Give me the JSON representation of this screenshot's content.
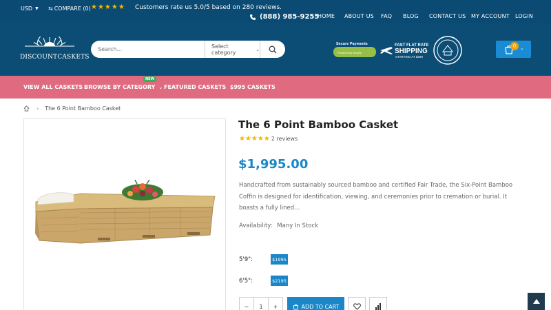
{
  "topbar": {
    "currency": "USD",
    "compare": "COMPARE (0)",
    "stars": "★★★★★",
    "rating_text": "Customers rate us 5.0/5 based on 280 reviews.",
    "phone": "(888) 985-9255",
    "nav": [
      "HOME",
      "ABOUT US",
      "FAQ",
      "BLOG",
      "CONTACT US",
      "MY ACCOUNT",
      "LOGIN"
    ]
  },
  "header": {
    "logo_text": "DISCOUNTCASKETS",
    "search_placeholder": "Search...",
    "category_select": "Select category",
    "secure_payments": "Secure Payments",
    "shopify_label": "Powered by shopify",
    "shipping_line1": "FAST FLAT RATE",
    "shipping_line2": "SHIPPING",
    "shipping_line3": "STARTING AT $299",
    "cart_count": "0"
  },
  "menu": {
    "items": [
      "VIEW ALL CASKETS",
      "BROWSE BY CATEGORY",
      "FEATURED CASKETS",
      "$995 CASKETS"
    ],
    "new_badge": "NEW"
  },
  "breadcrumb": {
    "current": "The 6 Point Bamboo Casket"
  },
  "product": {
    "title": "The 6 Point Bamboo Casket",
    "stars": "★★★★★",
    "reviews": "2 reviews",
    "rating": 5,
    "price": "$1,995.00",
    "description": "Handcrafted from sustainably sourced bamboo and certified Fair Trade, the Six-Point Bamboo Coffin is designed for identification, viewing, and ceremonies prior to cremation or burial. It boasts a fully lined...",
    "availability_label": "Availability:",
    "availability_value": "Many In Stock",
    "sizes": [
      {
        "label": "5'9\":",
        "price": "$1995"
      },
      {
        "label": "6'5\":",
        "price": "$2195"
      }
    ],
    "quantity": "1",
    "minus": "−",
    "plus": "+",
    "add_to_cart": "ADD TO CART"
  },
  "colors": {
    "topbar": "#0a4a73",
    "menu": "#e06b80",
    "accent": "#1b86c8",
    "star": "#f5b400"
  },
  "icons": [
    "chevron-down-icon",
    "compare-icon",
    "phone-icon",
    "search-icon",
    "cart-icon",
    "home-icon",
    "heart-icon",
    "bar-chart-icon",
    "arrow-up-icon",
    "airplane-icon"
  ]
}
